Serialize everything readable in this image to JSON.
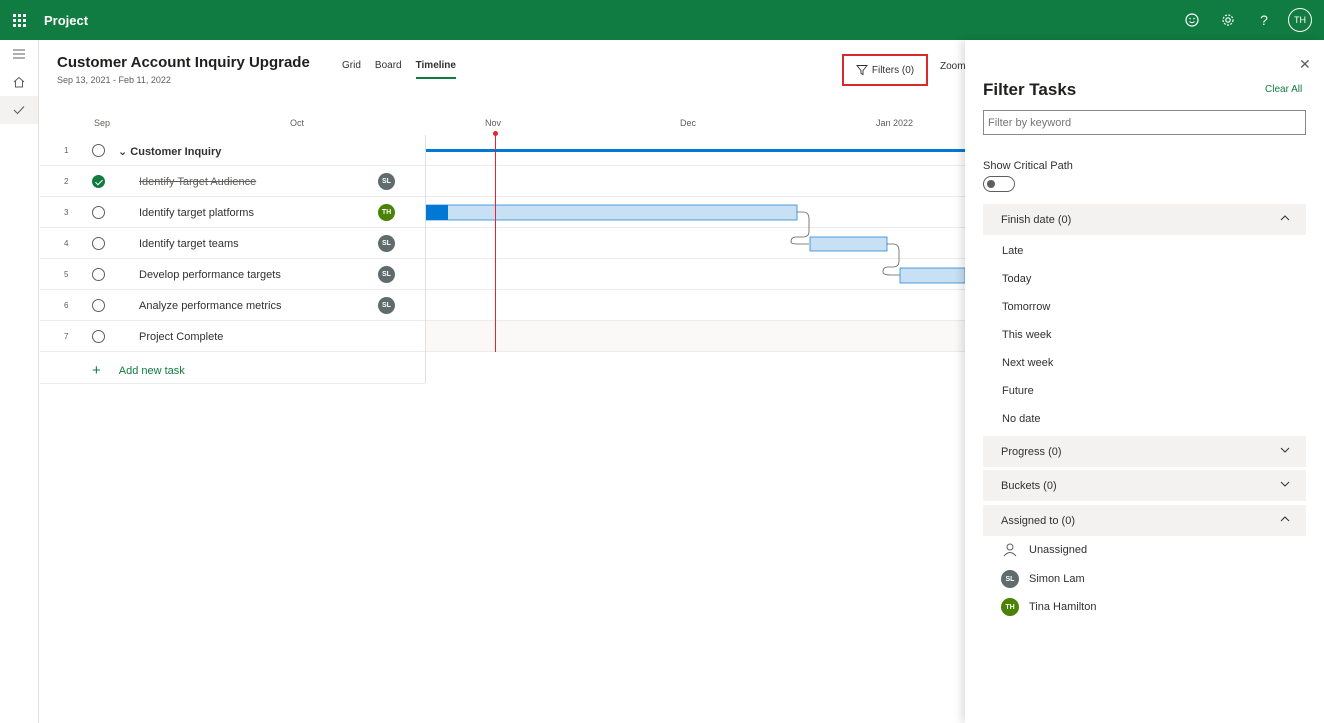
{
  "app": {
    "name": "Project"
  },
  "topbar": {
    "user_initials": "TH"
  },
  "plan": {
    "title": "Customer Account Inquiry Upgrade",
    "dates": "Sep 13, 2021 - Feb 11, 2022"
  },
  "views": {
    "grid": "Grid",
    "board": "Board",
    "timeline": "Timeline"
  },
  "toolbar": {
    "filters_label": "Filters (0)",
    "zoom_label": "Zoom"
  },
  "months": [
    "Sep",
    "Oct",
    "Nov",
    "Dec",
    "Jan 2022"
  ],
  "tasks": [
    {
      "num": "1",
      "name": "Customer Inquiry",
      "group": true,
      "done": false,
      "assignee": ""
    },
    {
      "num": "2",
      "name": "Identify Target Audience",
      "done": true,
      "assignee": "SL"
    },
    {
      "num": "3",
      "name": "Identify target platforms",
      "done": false,
      "assignee": "TH"
    },
    {
      "num": "4",
      "name": "Identify target teams",
      "done": false,
      "assignee": "SL"
    },
    {
      "num": "5",
      "name": "Develop performance targets",
      "done": false,
      "assignee": "SL"
    },
    {
      "num": "6",
      "name": "Analyze performance metrics",
      "done": false,
      "assignee": "SL"
    },
    {
      "num": "7",
      "name": "Project Complete",
      "done": false,
      "assignee": ""
    }
  ],
  "add_task_label": "Add new task",
  "colors": {
    "brand": "#107c41",
    "today": "#e8222f",
    "bar": "#c7e0f4",
    "bar_progress": "#0078d4",
    "sl": "#5f6b6d",
    "th": "#498205"
  },
  "filter_panel": {
    "title": "Filter Tasks",
    "clear_all": "Clear All",
    "keyword_placeholder": "Filter by keyword",
    "critical_path_label": "Show Critical Path",
    "finish_date": {
      "label": "Finish date (0)",
      "options": [
        "Late",
        "Today",
        "Tomorrow",
        "This week",
        "Next week",
        "Future",
        "No date"
      ]
    },
    "progress": {
      "label": "Progress (0)"
    },
    "buckets": {
      "label": "Buckets (0)"
    },
    "assigned_to": {
      "label": "Assigned to (0)",
      "unassigned": "Unassigned",
      "people": [
        {
          "initials": "SL",
          "name": "Simon Lam"
        },
        {
          "initials": "TH",
          "name": "Tina Hamilton"
        }
      ]
    }
  }
}
